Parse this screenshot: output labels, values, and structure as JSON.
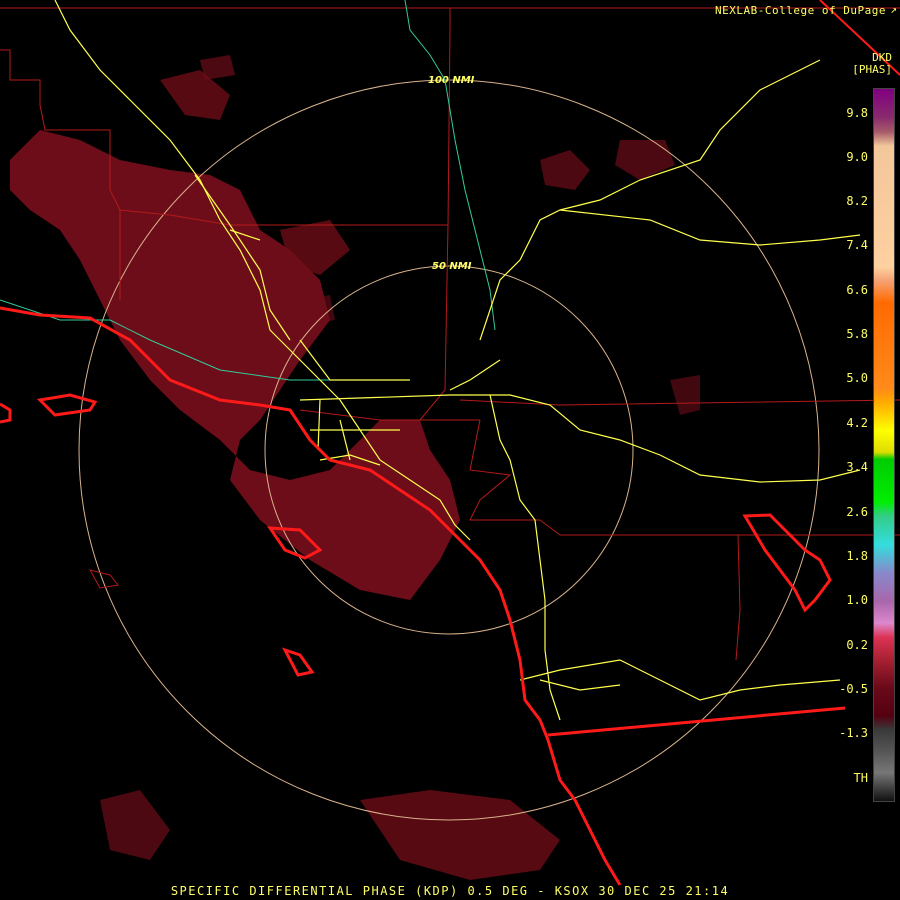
{
  "header": {
    "credit": "NEXLAB-College of DuPage"
  },
  "map": {
    "range_rings": [
      "50 NMI",
      "100 NMI"
    ]
  },
  "legend": {
    "product": "DKD",
    "units": "[PHAS]",
    "labels": [
      "9.8",
      "9.0",
      "8.2",
      "7.4",
      "6.6",
      "5.8",
      "5.0",
      "4.2",
      "3.4",
      "2.6",
      "1.8",
      "1.0",
      "0.2",
      "-0.5",
      "-1.3",
      "TH"
    ]
  },
  "footer": {
    "caption": "SPECIFIC DIFFERENTIAL PHASE (KDP) 0.5 DEG - KSOX 30 DEC 25 21:14"
  },
  "colors": {
    "echo": "#7a0f1c",
    "coastline": "#ff1a1a",
    "roads": "#ffff4d",
    "county_lines": "#b31a1a",
    "rivers": "#33cc99",
    "range_rings": "#d9b38c",
    "text": "#ffff66"
  }
}
